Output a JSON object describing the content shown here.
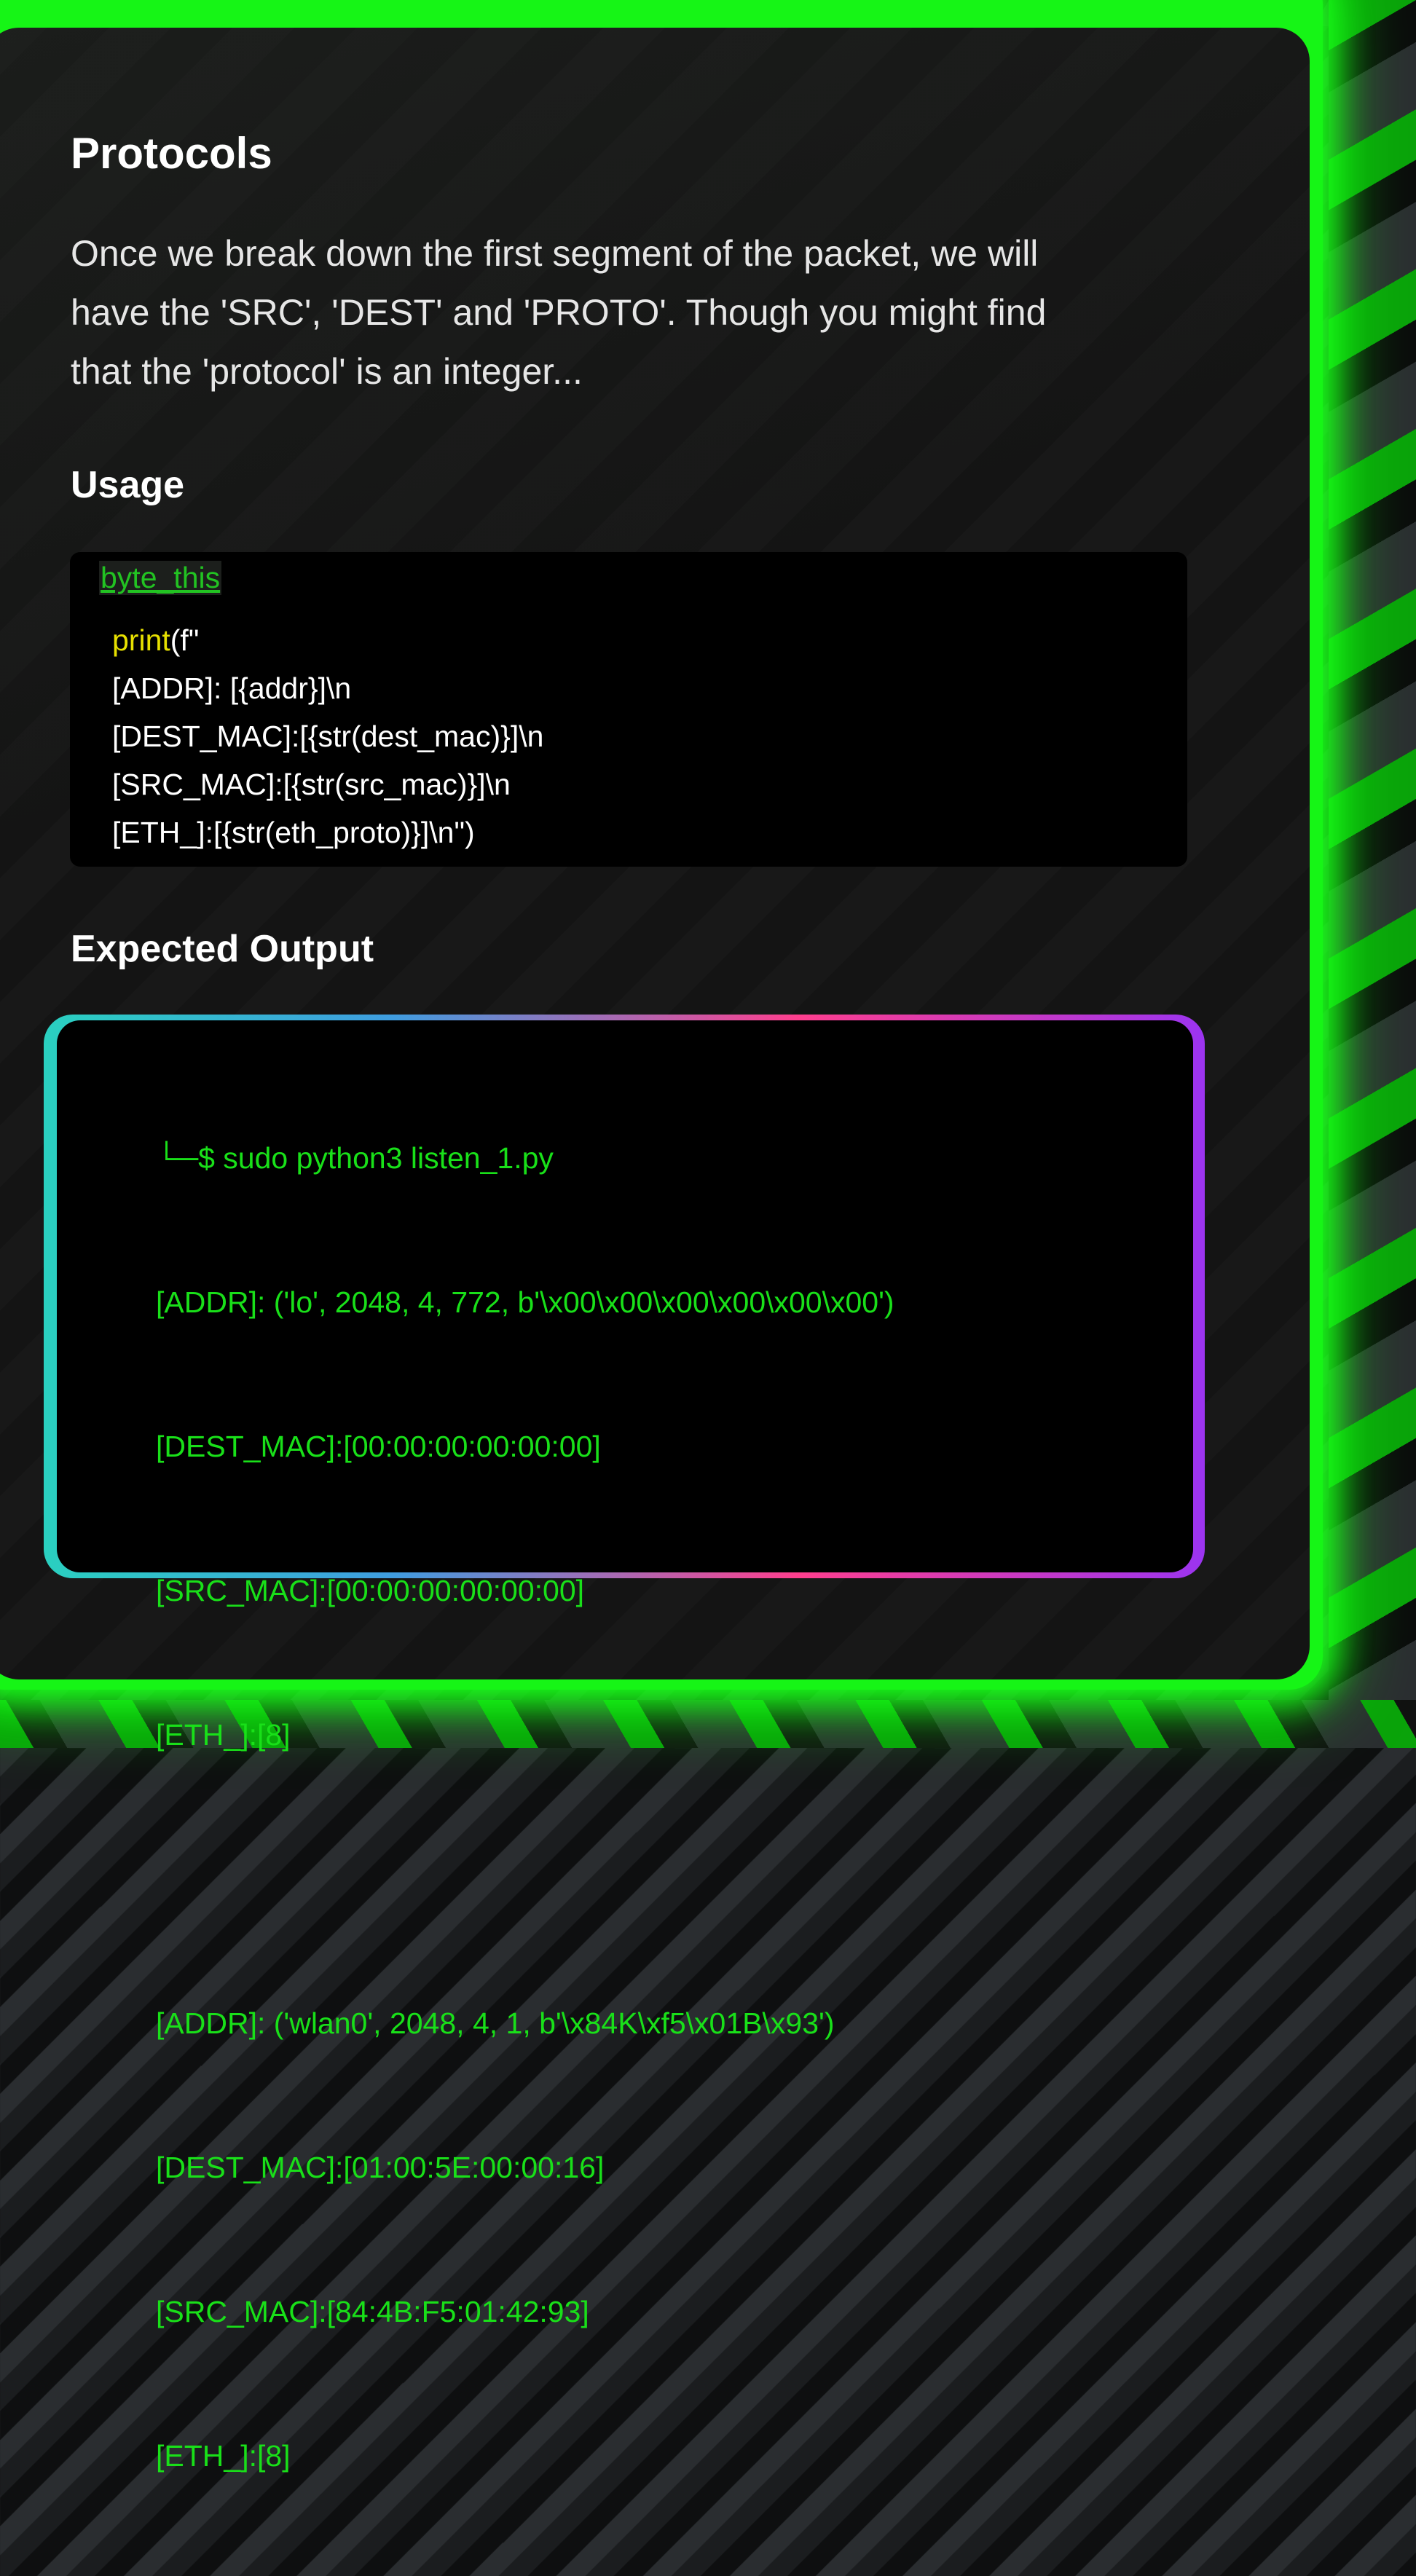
{
  "colors": {
    "accent_green": "#19e019",
    "code_function": "#e7e000",
    "card_background": "#141414",
    "frame_glow": "#16f516"
  },
  "section": {
    "title": "Protocols",
    "intro_line1": "Once we break down the first segment of the packet, we will",
    "intro_line2": "have the 'SRC', 'DEST' and 'PROTO'. Though you might find",
    "intro_line3": "that the 'protocol' is an integer..."
  },
  "usage": {
    "heading": "Usage",
    "filename": "byte_this",
    "code": {
      "fn_name": "print",
      "line1_rest": "(f\"",
      "line2": "[ADDR]: [{addr}]\\n",
      "line3": "[DEST_MAC]:[{str(dest_mac)}]\\n",
      "line4": "[SRC_MAC]:[{str(src_mac)}]\\n",
      "line5": "[ETH_]:[{str(eth_proto)}]\\n\")"
    }
  },
  "output": {
    "heading": "Expected Output",
    "lines": [
      "└─$ sudo python3 listen_1.py",
      "[ADDR]: ('lo', 2048, 4, 772, b'\\x00\\x00\\x00\\x00\\x00\\x00')",
      "[DEST_MAC]:[00:00:00:00:00:00]",
      "[SRC_MAC]:[00:00:00:00:00:00]",
      "[ETH_]:[8]",
      "",
      "[ADDR]: ('wlan0', 2048, 4, 1, b'\\x84K\\xf5\\x01B\\x93')",
      "[DEST_MAC]:[01:00:5E:00:00:16]",
      "[SRC_MAC]:[84:4B:F5:01:42:93]",
      "[ETH_]:[8]"
    ]
  }
}
